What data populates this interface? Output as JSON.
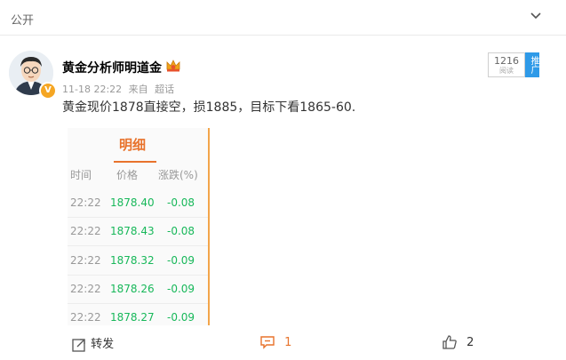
{
  "visibility": "公开",
  "post": {
    "author": "黄金分析师明道金",
    "datetime": "11-18 22:22",
    "source_prefix": "来自",
    "source": "超话",
    "text": "黄金现价1878直接空，损1885，目标下看1865-60.",
    "reads": {
      "count": "1216",
      "label": "阅读",
      "promo": "推广"
    }
  },
  "stock_image": {
    "tab": "明细",
    "headers": [
      "时间",
      "价格",
      "涨跌(%)"
    ],
    "rows": [
      {
        "time": "22:22",
        "price": "1878.40",
        "change": "-0.08"
      },
      {
        "time": "22:22",
        "price": "1878.43",
        "change": "-0.08"
      },
      {
        "time": "22:22",
        "price": "1878.32",
        "change": "-0.09"
      },
      {
        "time": "22:22",
        "price": "1878.26",
        "change": "-0.09"
      },
      {
        "time": "22:22",
        "price": "1878.27",
        "change": "-0.09"
      }
    ],
    "price_color": "#18b85a",
    "accent_color": "#e8732c"
  },
  "actions": {
    "repost_label": "转发",
    "comment_count": "1",
    "like_count": "2",
    "comment_color": "#e8732c"
  },
  "icons": [
    "chevron-down-icon",
    "crown-icon",
    "verified-v-icon",
    "repost-icon",
    "comment-icon",
    "like-icon"
  ]
}
